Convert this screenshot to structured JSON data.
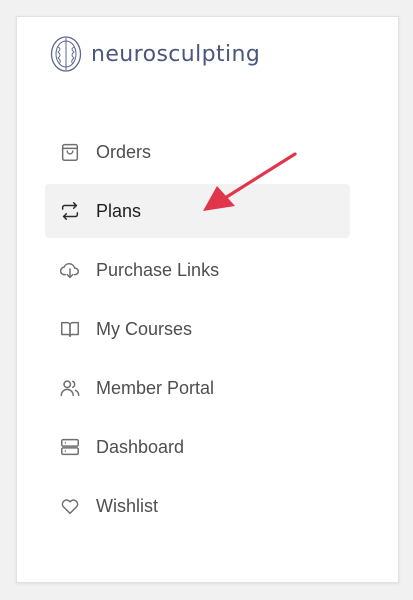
{
  "brand": {
    "name": "neurosculpting",
    "logo_icon": "brain-logo-icon",
    "color": "#4a567e"
  },
  "nav": {
    "items": [
      {
        "label": "Orders",
        "icon": "shopping-bag-icon",
        "active": false
      },
      {
        "label": "Plans",
        "icon": "repeat-arrows-icon",
        "active": true
      },
      {
        "label": "Purchase Links",
        "icon": "cloud-download-icon",
        "active": false
      },
      {
        "label": "My Courses",
        "icon": "open-book-icon",
        "active": false
      },
      {
        "label": "Member Portal",
        "icon": "users-icon",
        "active": false
      },
      {
        "label": "Dashboard",
        "icon": "server-icon",
        "active": false
      },
      {
        "label": "Wishlist",
        "icon": "heart-icon",
        "active": false
      }
    ]
  },
  "annotation": {
    "arrow_color": "#e0354a"
  }
}
